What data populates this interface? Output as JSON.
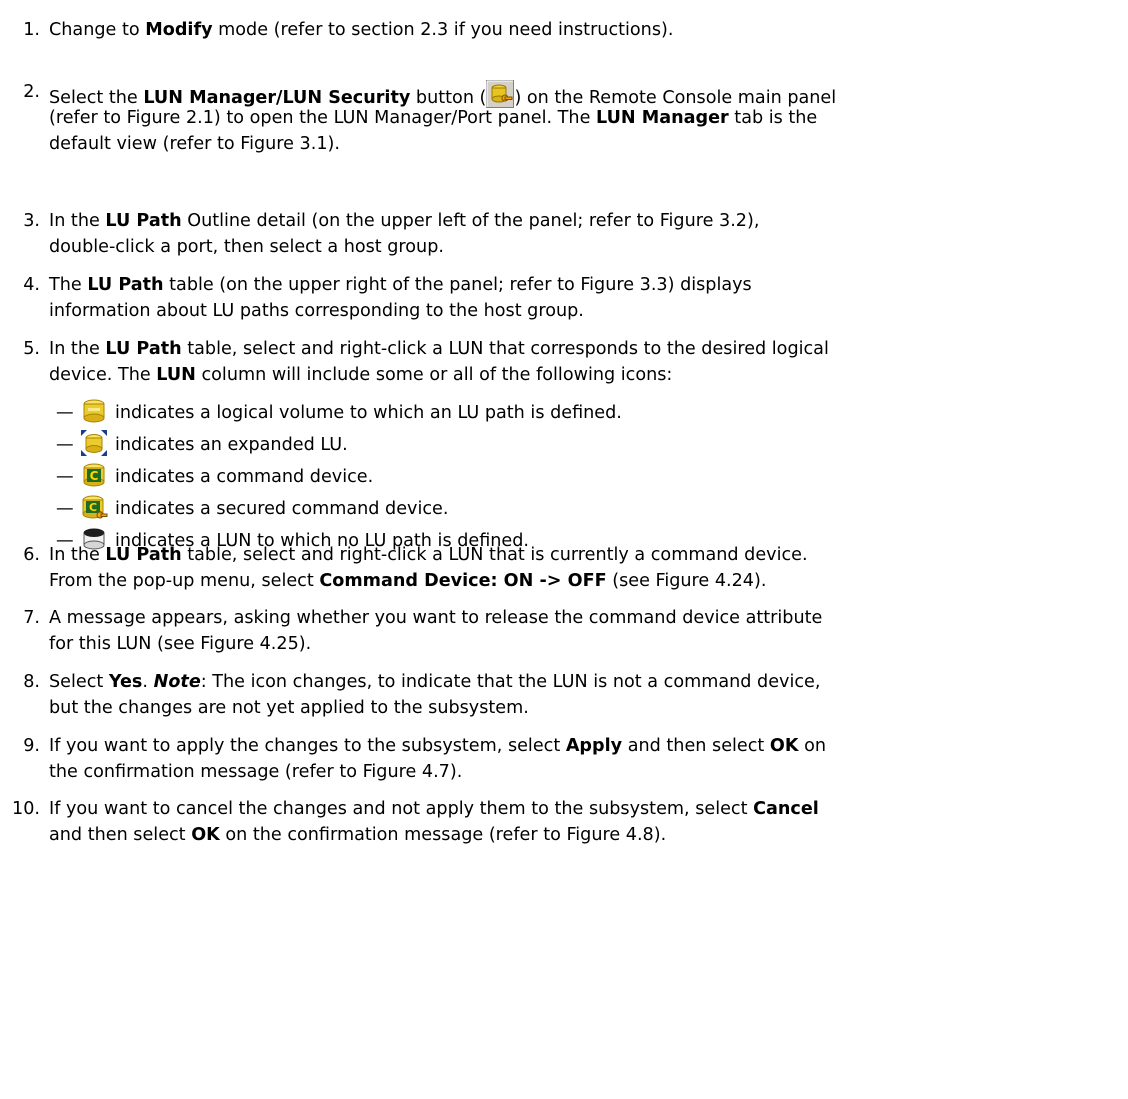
{
  "steps": [
    {
      "num": "1.",
      "lines": [
        [
          "Change to ",
          {
            "b": "Modify"
          },
          " mode (refer to section 2.3 if you need instructions)."
        ]
      ]
    },
    {
      "num": "2.",
      "lines": [
        [
          "Select the ",
          {
            "b": "LUN Manager/LUN Security"
          },
          " button (",
          {
            "icon": "lun-security-button-icon"
          },
          ") on the Remote Console main panel"
        ],
        [
          "(refer to Figure 2.1) to open the LUN Manager/Port panel. The ",
          {
            "b": "LUN Manager"
          },
          " tab is the"
        ],
        [
          "default view (refer to Figure 3.1)."
        ]
      ]
    },
    {
      "num": "3.",
      "lines": [
        [
          "In the ",
          {
            "b": "LU Path"
          },
          " Outline detail (on the upper left of the panel; refer to Figure 3.2),"
        ],
        [
          "double-click a port, then select a host group."
        ]
      ]
    },
    {
      "num": "4.",
      "lines": [
        [
          "The ",
          {
            "b": "LU Path"
          },
          " table (on the upper right of the panel; refer to Figure 3.3) displays"
        ],
        [
          "information about LU paths corresponding to the host group."
        ]
      ]
    },
    {
      "num": "5.",
      "lines": [
        [
          "In the ",
          {
            "b": "LU Path"
          },
          " table, select and right-click a LUN that corresponds to the desired logical"
        ],
        [
          "device. The ",
          {
            "b": "LUN"
          },
          " column will include some or all of the following icons:"
        ]
      ]
    },
    {
      "num": "6.",
      "lines": [
        [
          "In the ",
          {
            "b": "LU Path"
          },
          " table, select and right-click a LUN that is currently a command device."
        ],
        [
          "From the pop-up menu, select ",
          {
            "b": "Command Device: ON -> OFF"
          },
          " (see Figure 4.24)."
        ]
      ]
    },
    {
      "num": "7.",
      "lines": [
        [
          "A message appears, asking whether you want to release the command device attribute"
        ],
        [
          "for this LUN (see Figure 4.25)."
        ]
      ]
    },
    {
      "num": "8.",
      "lines": [
        [
          "Select ",
          {
            "b": "Yes"
          },
          ". ",
          {
            "bi": "Note"
          },
          ": The icon changes, to indicate that the LUN is not a command device,"
        ],
        [
          "but the changes are not yet applied to the subsystem."
        ]
      ]
    },
    {
      "num": "9.",
      "lines": [
        [
          "If you want to apply the changes to the subsystem, select ",
          {
            "b": "Apply"
          },
          " and then select ",
          {
            "b": "OK"
          },
          " on"
        ],
        [
          "the confirmation message (refer to Figure 4.7)."
        ]
      ]
    },
    {
      "num": "10.",
      "lines": [
        [
          "If you want to cancel the changes and not apply them to the subsystem, select ",
          {
            "b": "Cancel"
          }
        ],
        [
          "and then select ",
          {
            "b": "OK"
          },
          " on the confirmation message (refer to Figure 4.8)."
        ]
      ]
    }
  ],
  "icon_list": [
    {
      "icon": "lu-path-defined-volume-icon",
      "dash": "—",
      "text": "indicates a logical volume to which an LU path is defined."
    },
    {
      "icon": "expanded-lu-icon",
      "dash": "—",
      "text": "indicates an expanded LU."
    },
    {
      "icon": "command-device-icon",
      "dash": "—",
      "text": "indicates a command device."
    },
    {
      "icon": "secured-command-device-icon",
      "dash": "—",
      "text": "indicates a secured command device."
    },
    {
      "icon": "no-lu-path-lun-icon",
      "dash": "—",
      "text": "indicates a LUN to which no LU path is defined."
    }
  ]
}
